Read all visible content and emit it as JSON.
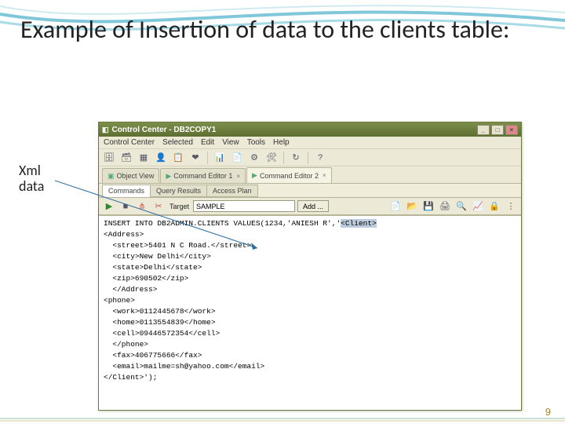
{
  "slide": {
    "title": "Example of Insertion of data to the clients table:",
    "annotation": "Xml\ndata",
    "page_number": "9"
  },
  "window": {
    "title": "Control Center - DB2COPY1",
    "menu": [
      "Control Center",
      "Selected",
      "Edit",
      "View",
      "Tools",
      "Help"
    ],
    "tabs": {
      "items": [
        {
          "label": "Object View"
        },
        {
          "label": "Command Editor 1"
        },
        {
          "label": "Command Editor 2"
        }
      ]
    },
    "subtabs": [
      "Commands",
      "Query Results",
      "Access Plan"
    ],
    "command_bar": {
      "target_label": "Target",
      "target_value": "SAMPLE",
      "add_label": "Add ..."
    },
    "sql": {
      "line1_pre": "INSERT INTO DB2ADMIN.CLIENTS VALUES(1234,'ANIESH R','",
      "line1_hl": "<Client>",
      "lines": "<Address>\n  <street>5401 N C Road.</street>\n  <city>New Delhi</city>\n  <state>Delhi</state>\n  <zip>690502</zip>\n  </Address>\n<phone>\n  <work>0112445678</work>\n  <home>0113554839</home>\n  <cell>09446572354</cell>\n  </phone>\n  <fax>406775666</fax>\n  <email>mailme=sh@yahoo.com</email>\n</Client>');"
    }
  }
}
